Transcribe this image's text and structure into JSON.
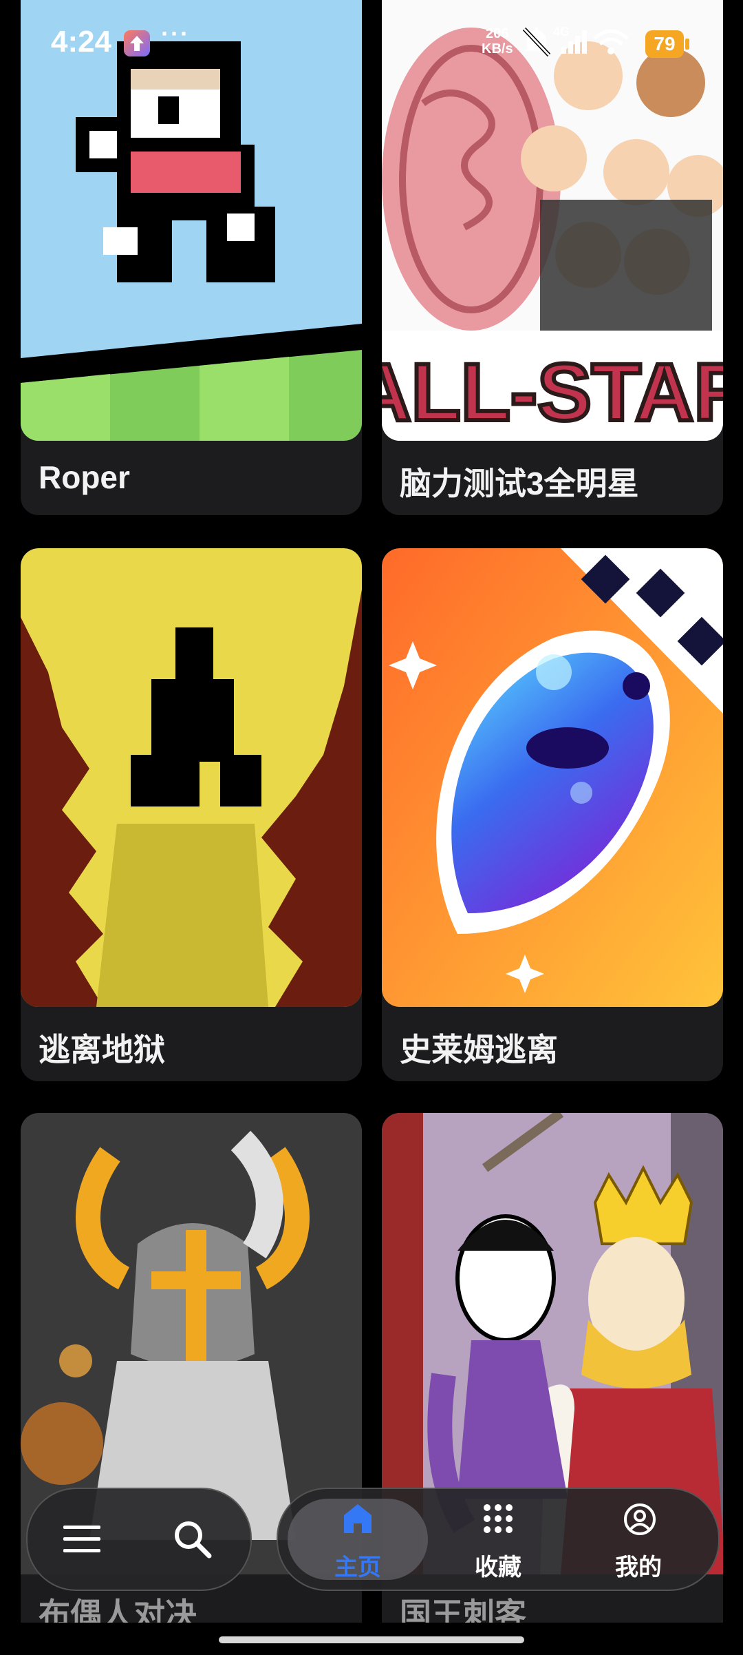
{
  "status_bar": {
    "time": "4:24",
    "more": "···",
    "net_speed_value": "206",
    "net_speed_unit": "KB/s",
    "network": "4G",
    "battery": "79"
  },
  "games": [
    {
      "title": "Roper",
      "icon": "roper-art"
    },
    {
      "title": "脑力测试3全明星",
      "icon": "brain-test-art",
      "art_text": "ALL-STAR"
    },
    {
      "title": "逃离地狱",
      "icon": "escape-hell-art"
    },
    {
      "title": "史莱姆逃离",
      "icon": "slime-escape-art"
    },
    {
      "title": "布偶人对决",
      "icon": "ragdoll-duel-art"
    },
    {
      "title": "国王刺客",
      "icon": "king-assassin-art"
    }
  ],
  "bottom_nav": {
    "menu_icon": "menu-icon",
    "search_icon": "search-icon",
    "tabs": [
      {
        "label": "主页",
        "icon": "home-icon",
        "active": true
      },
      {
        "label": "收藏",
        "icon": "grid-icon",
        "active": false
      },
      {
        "label": "我的",
        "icon": "profile-icon",
        "active": false
      }
    ],
    "active_color": "#3478f6"
  }
}
